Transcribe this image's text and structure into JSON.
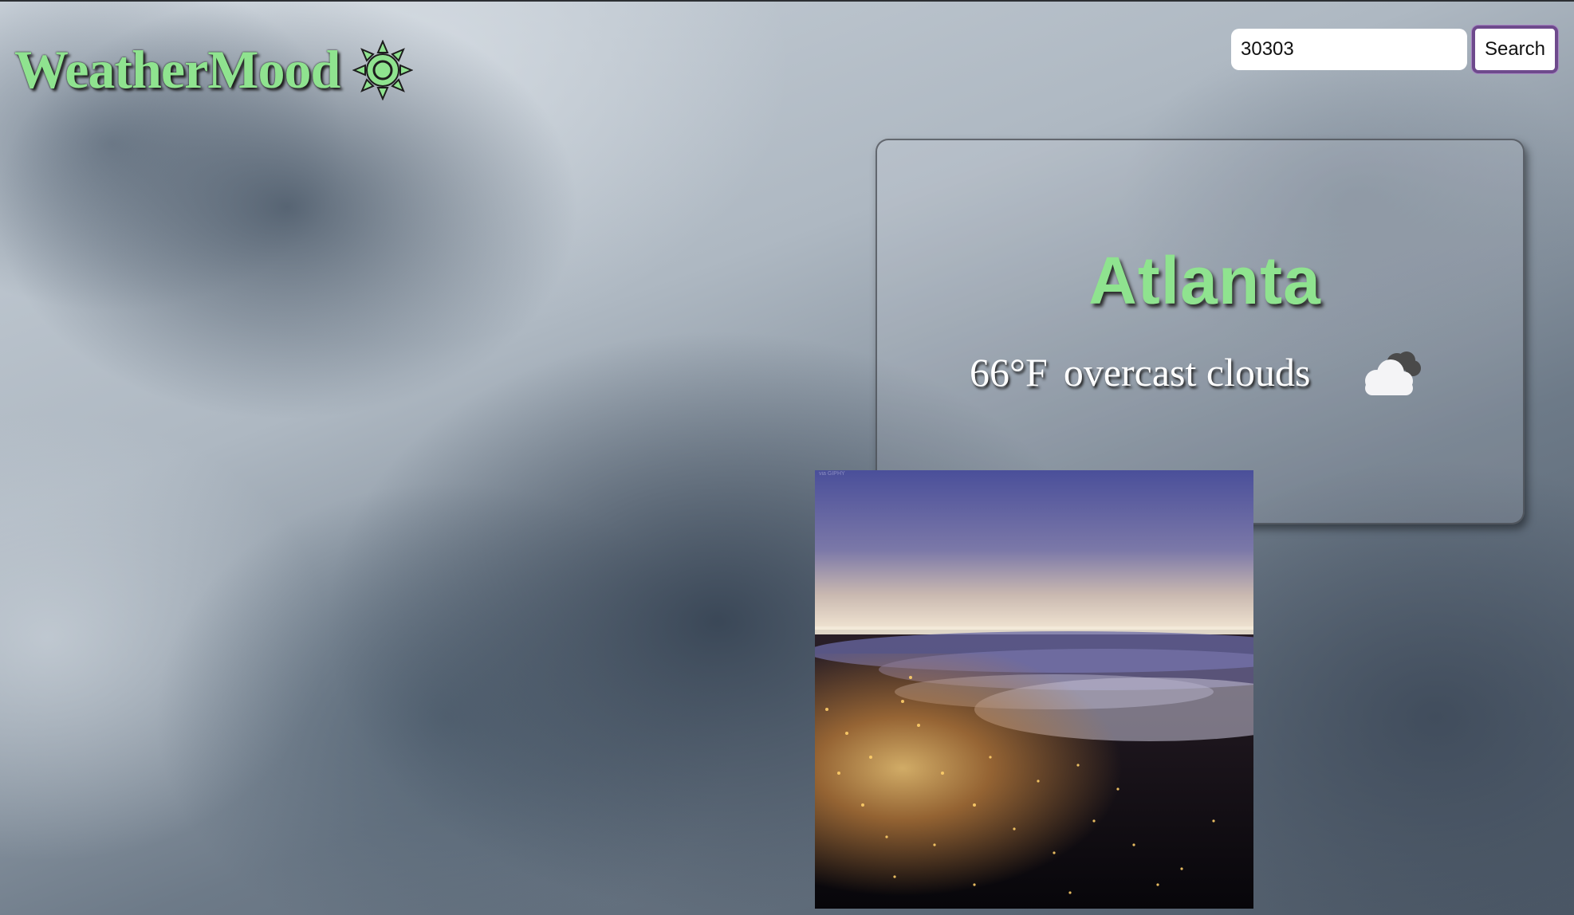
{
  "header": {
    "logo_text": "WeatherMood",
    "logo_icon": "sun-icon",
    "logo_color": "#8fe38f"
  },
  "search": {
    "value": "30303",
    "button_label": "Search",
    "button_border_color": "#6e4a8c"
  },
  "weather": {
    "city": "Atlanta",
    "temperature": "66°F",
    "description": "overcast clouds",
    "icon": "cloud-moon-icon"
  },
  "media": {
    "photo": "night-city-fog-gif",
    "caption": "via GIPHY"
  }
}
